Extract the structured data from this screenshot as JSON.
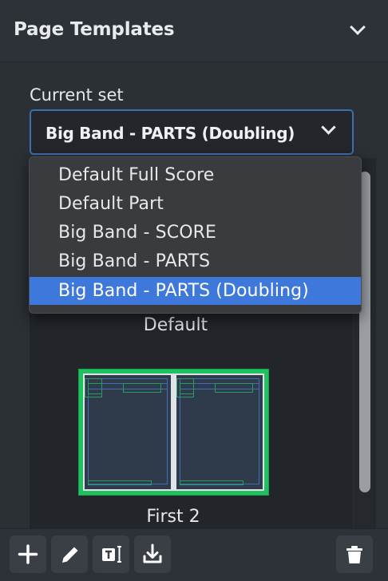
{
  "panel": {
    "title": "Page Templates",
    "collapse_icon": "chevron-down-icon"
  },
  "current_set": {
    "label": "Current set",
    "selected": "Big Band - PARTS (Doubling)"
  },
  "dropdown": {
    "options": [
      "Default Full Score",
      "Default Part",
      "Big Band - SCORE",
      "Big Band - PARTS",
      "Big Band - PARTS (Doubling)"
    ],
    "selected_index": 4
  },
  "templates": {
    "items": [
      {
        "label": "Default"
      },
      {
        "label": "First 2",
        "selected": true
      }
    ]
  },
  "toolbar": {
    "buttons": [
      "plus-icon",
      "pencil-icon",
      "text-frame-icon",
      "import-icon",
      "trash-icon"
    ]
  },
  "colors": {
    "selection": "#3e78db",
    "accent_border": "#3e6fb0",
    "thumbnail_highlight": "#1fc25f"
  }
}
